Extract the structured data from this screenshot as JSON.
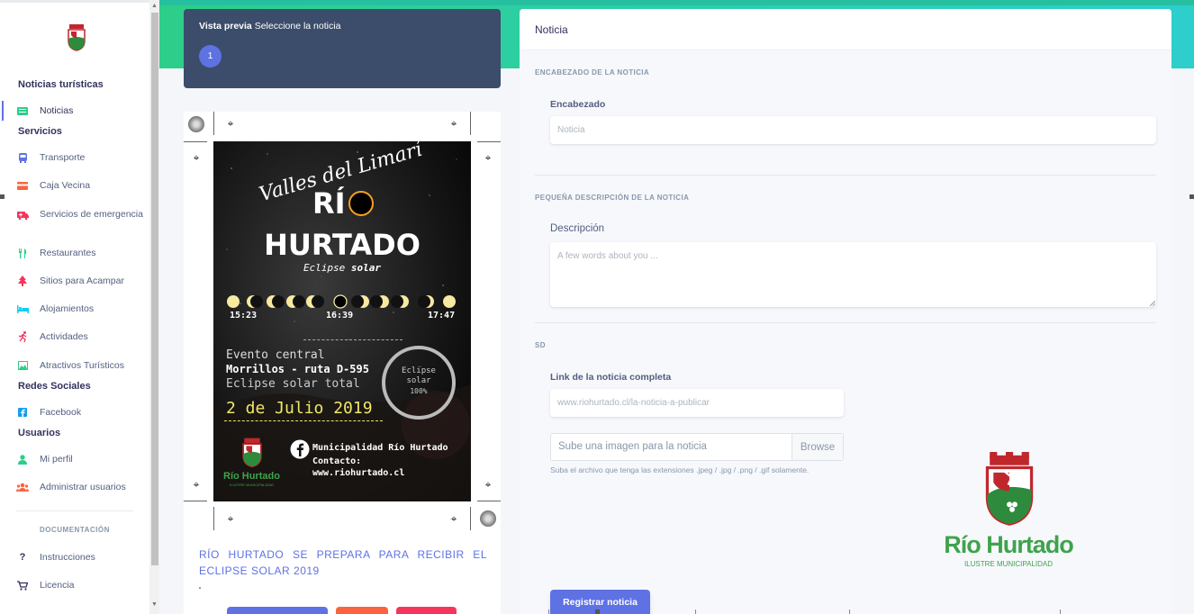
{
  "sidebar": {
    "sections": [
      {
        "heading": "Noticias turísticas"
      },
      {
        "heading": "Servicios"
      },
      {
        "heading": "Redes Sociales"
      },
      {
        "heading": "Usuarios"
      }
    ],
    "items": {
      "noticias": {
        "label": "Noticias",
        "icon": "newspaper-icon"
      },
      "transporte": {
        "label": "Transporte",
        "icon": "bus-icon"
      },
      "caja": {
        "label": "Caja Vecina",
        "icon": "credit-card-icon"
      },
      "emergencia": {
        "label": "Servicios de emergencia",
        "icon": "ambulance-icon"
      },
      "restaurantes": {
        "label": "Restaurantes",
        "icon": "utensils-icon"
      },
      "acampar": {
        "label": "Sitios para Acampar",
        "icon": "tree-icon"
      },
      "alojamientos": {
        "label": "Alojamientos",
        "icon": "bed-icon"
      },
      "actividades": {
        "label": "Actividades",
        "icon": "running-icon"
      },
      "atractivos": {
        "label": "Atractivos Turísticos",
        "icon": "image-icon"
      },
      "facebook": {
        "label": "Facebook",
        "icon": "facebook-icon"
      },
      "perfil": {
        "label": "Mi perfil",
        "icon": "user-icon"
      },
      "admin": {
        "label": "Administrar usuarios",
        "icon": "users-icon"
      },
      "instrucciones": {
        "label": "Instrucciones",
        "icon": "question-icon"
      },
      "licencia": {
        "label": "Licencia",
        "icon": "cart-icon"
      }
    },
    "doc_heading": "DOCUMENTACIÓN"
  },
  "preview": {
    "title_bold": "Vista previa",
    "title_rest": "Seleccione la noticia",
    "badge": "1",
    "news_title": "RÍO HURTADO SE PREPARA PARA RECIBIR EL ECLIPSE SOLAR 2019"
  },
  "poster": {
    "script": "Valles del Limarí",
    "rio": "RÍ",
    "hurtado": "HURTADO",
    "eclipse_light": "Eclipse",
    "eclipse_bold": "solar",
    "t1": "15:23",
    "t2": "16:39",
    "t3": "17:47",
    "evento": "Evento central",
    "lugar": "Morrillos - ruta D-595",
    "total": "Eclipse solar total",
    "fecha": "2 de Julio 2019",
    "ring1": "Eclipse",
    "ring2": "solar",
    "ring3": "100%",
    "muni": "Municipalidad Río Hurtado",
    "contacto": "Contacto:",
    "web": "www.riohurtado.cl",
    "logo_name": "Río Hurtado",
    "logo_sub": "ILUSTRE MUNICIPALIDAD"
  },
  "form": {
    "title": "Noticia",
    "sec1": "ENCABEZADO DE LA NOTICIA",
    "encabezado_label": "Encabezado",
    "encabezado_placeholder": "Noticia",
    "sec2": "PEQUEÑA DESCRIPCIÓN DE LA NOTICIA",
    "desc_label": "Descripción",
    "desc_placeholder": "A few words about you ...",
    "sec3": "SD",
    "link_label": "Link de la noticia completa",
    "link_placeholder": "www.riohurtado.cl/la-noticia-a-publicar",
    "file_placeholder": "Sube una imagen para la noticia",
    "browse": "Browse",
    "help": "Suba el archivo que tenga las extensiones .jpeg / .jpg / .png / .gif solamente.",
    "submit": "Registrar noticia"
  },
  "logo": {
    "name": "Río Hurtado",
    "sub": "ILUSTRE MUNICIPALIDAD"
  },
  "colors": {
    "primary": "#5e72e4",
    "green": "#2dce89",
    "teal": "#2dcecc",
    "dark_card": "#3c4d6b",
    "brand_green": "#2e8b3e",
    "brand_red": "#c0272d"
  }
}
